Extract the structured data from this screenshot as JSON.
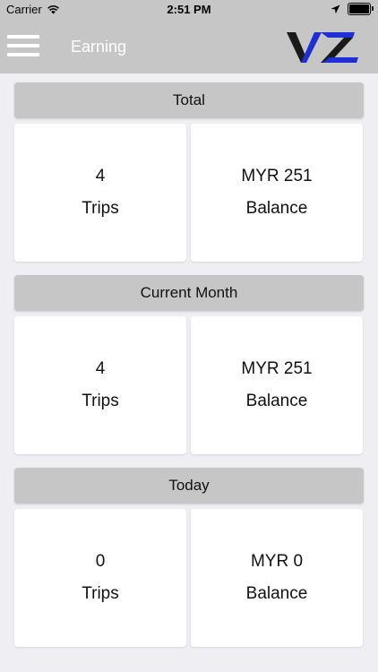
{
  "status_bar": {
    "carrier": "Carrier",
    "time": "2:51 PM"
  },
  "nav": {
    "title": "Earning",
    "logo_text": "VZ"
  },
  "sections": [
    {
      "title": "Total",
      "trips_value": "4",
      "trips_label": "Trips",
      "balance_value": "MYR 251",
      "balance_label": "Balance"
    },
    {
      "title": "Current Month",
      "trips_value": "4",
      "trips_label": "Trips",
      "balance_value": "MYR 251",
      "balance_label": "Balance"
    },
    {
      "title": "Today",
      "trips_value": "0",
      "trips_label": "Trips",
      "balance_value": "MYR 0",
      "balance_label": "Balance"
    }
  ],
  "colors": {
    "nav_background": "#c6c6c6",
    "page_background": "#eeeef3",
    "card_background": "#ffffff",
    "logo_blue": "#1f2fd6"
  }
}
